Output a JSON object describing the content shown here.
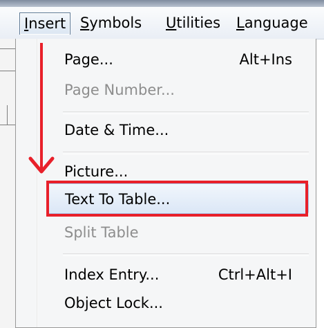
{
  "menubar": {
    "items": [
      {
        "mnemonic": "I",
        "rest": "nsert"
      },
      {
        "mnemonic": "S",
        "rest": "ymbols"
      },
      {
        "mnemonic": "U",
        "rest": "tilities"
      },
      {
        "mnemonic": "L",
        "rest": "anguage"
      }
    ]
  },
  "menu": {
    "items": [
      {
        "label": "Page...",
        "shortcut": "Alt+Ins",
        "state": "enabled"
      },
      {
        "label": "Page Number...",
        "state": "disabled"
      },
      {
        "label": "Date & Time...",
        "state": "enabled"
      },
      {
        "label": "Picture...",
        "state": "enabled"
      },
      {
        "label": "Text To Table...",
        "state": "hover"
      },
      {
        "label": "Split Table",
        "state": "disabled"
      },
      {
        "label": "Index Entry...",
        "shortcut": "Ctrl+Alt+I",
        "state": "enabled"
      },
      {
        "label": "Object Lock...",
        "state": "enabled"
      }
    ]
  },
  "annotation": {
    "arrow_color": "#e8202a",
    "highlight_color": "#e8202a"
  }
}
